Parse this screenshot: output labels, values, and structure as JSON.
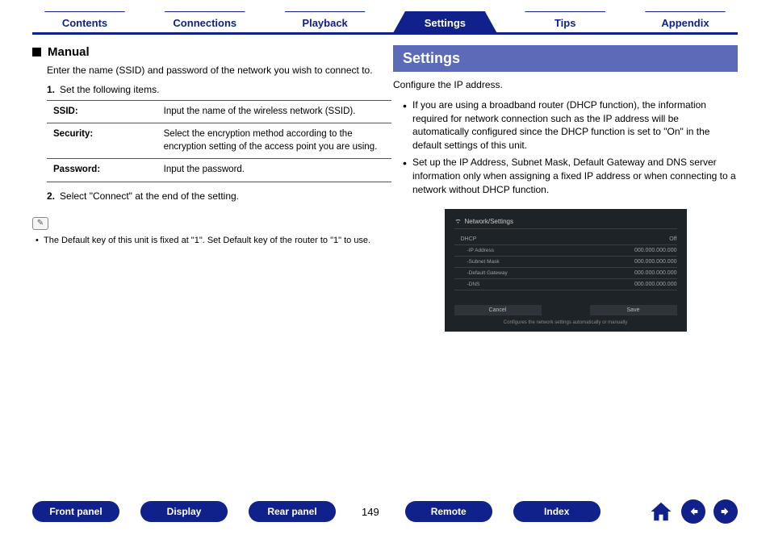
{
  "topTabs": [
    {
      "label": "Contents",
      "active": false
    },
    {
      "label": "Connections",
      "active": false
    },
    {
      "label": "Playback",
      "active": false
    },
    {
      "label": "Settings",
      "active": true
    },
    {
      "label": "Tips",
      "active": false
    },
    {
      "label": "Appendix",
      "active": false
    }
  ],
  "left": {
    "heading": "Manual",
    "intro": "Enter the name (SSID) and password of the network you wish to connect to.",
    "step1": "Set the following items.",
    "table": [
      {
        "key": "SSID:",
        "val": "Input the name of the wireless network (SSID)."
      },
      {
        "key": "Security:",
        "val": "Select the encryption method according to the encryption setting of the access point you are using."
      },
      {
        "key": "Password:",
        "val": "Input the password."
      }
    ],
    "step2": "Select \"Connect\" at the end of the setting.",
    "note": "The Default key of this unit is fixed at \"1\". Set Default key of the router to \"1\" to use."
  },
  "right": {
    "heading": "Settings",
    "intro": "Configure the IP address.",
    "bullets": [
      "If you are using a broadband router (DHCP function), the information required for network connection such as the IP address will be automatically configured since the DHCP function is set to \"On\" in the default settings of this unit.",
      "Set up the IP Address, Subnet Mask, Default Gateway and DNS server information only when assigning a fixed IP address or when connecting to a network without DHCP function."
    ],
    "osd": {
      "title": "Network/Settings",
      "rows": [
        {
          "label": "DHCP",
          "value": "Off",
          "sub": false
        },
        {
          "label": "-IP Address",
          "value": "000.000.000.000",
          "sub": true
        },
        {
          "label": "-Subnet Mask",
          "value": "000.000.000.000",
          "sub": true
        },
        {
          "label": "-Default Gateway",
          "value": "000.000.000.000",
          "sub": true
        },
        {
          "label": "-DNS",
          "value": "000.000.000.000",
          "sub": true
        }
      ],
      "cancel": "Cancel",
      "save": "Save",
      "footer": "Configures the network settings automatically or manually"
    }
  },
  "bottom": {
    "buttons": [
      "Front panel",
      "Display",
      "Rear panel"
    ],
    "page": "149",
    "buttons2": [
      "Remote",
      "Index"
    ]
  }
}
